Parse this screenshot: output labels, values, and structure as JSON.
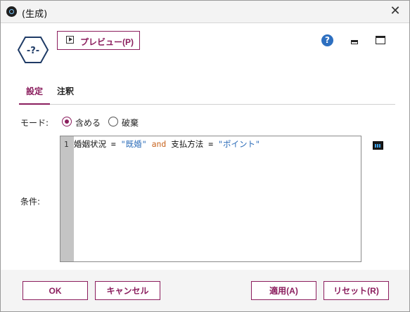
{
  "window": {
    "title": "(生成)"
  },
  "toolbar": {
    "preview_label": "プレビュー(P)",
    "help_glyph": "?"
  },
  "tabs": [
    {
      "label": "設定"
    },
    {
      "label": "注釈"
    }
  ],
  "mode": {
    "label": "モード:",
    "options": [
      "含める",
      "破棄"
    ],
    "selected": "含める"
  },
  "condition": {
    "label": "条件:",
    "line_number": "1",
    "tokens": [
      "婚姻状況",
      " = ",
      "\"既婚\"",
      " and ",
      "支払方法",
      " = ",
      "\"ポイント\""
    ]
  },
  "buttons": {
    "ok": "OK",
    "cancel": "キャンセル",
    "apply": "適用(A)",
    "reset": "リセット(R)"
  },
  "colors": {
    "accent": "#8b1e5e",
    "string": "#2a6bb8",
    "keyword": "#c8641e"
  }
}
